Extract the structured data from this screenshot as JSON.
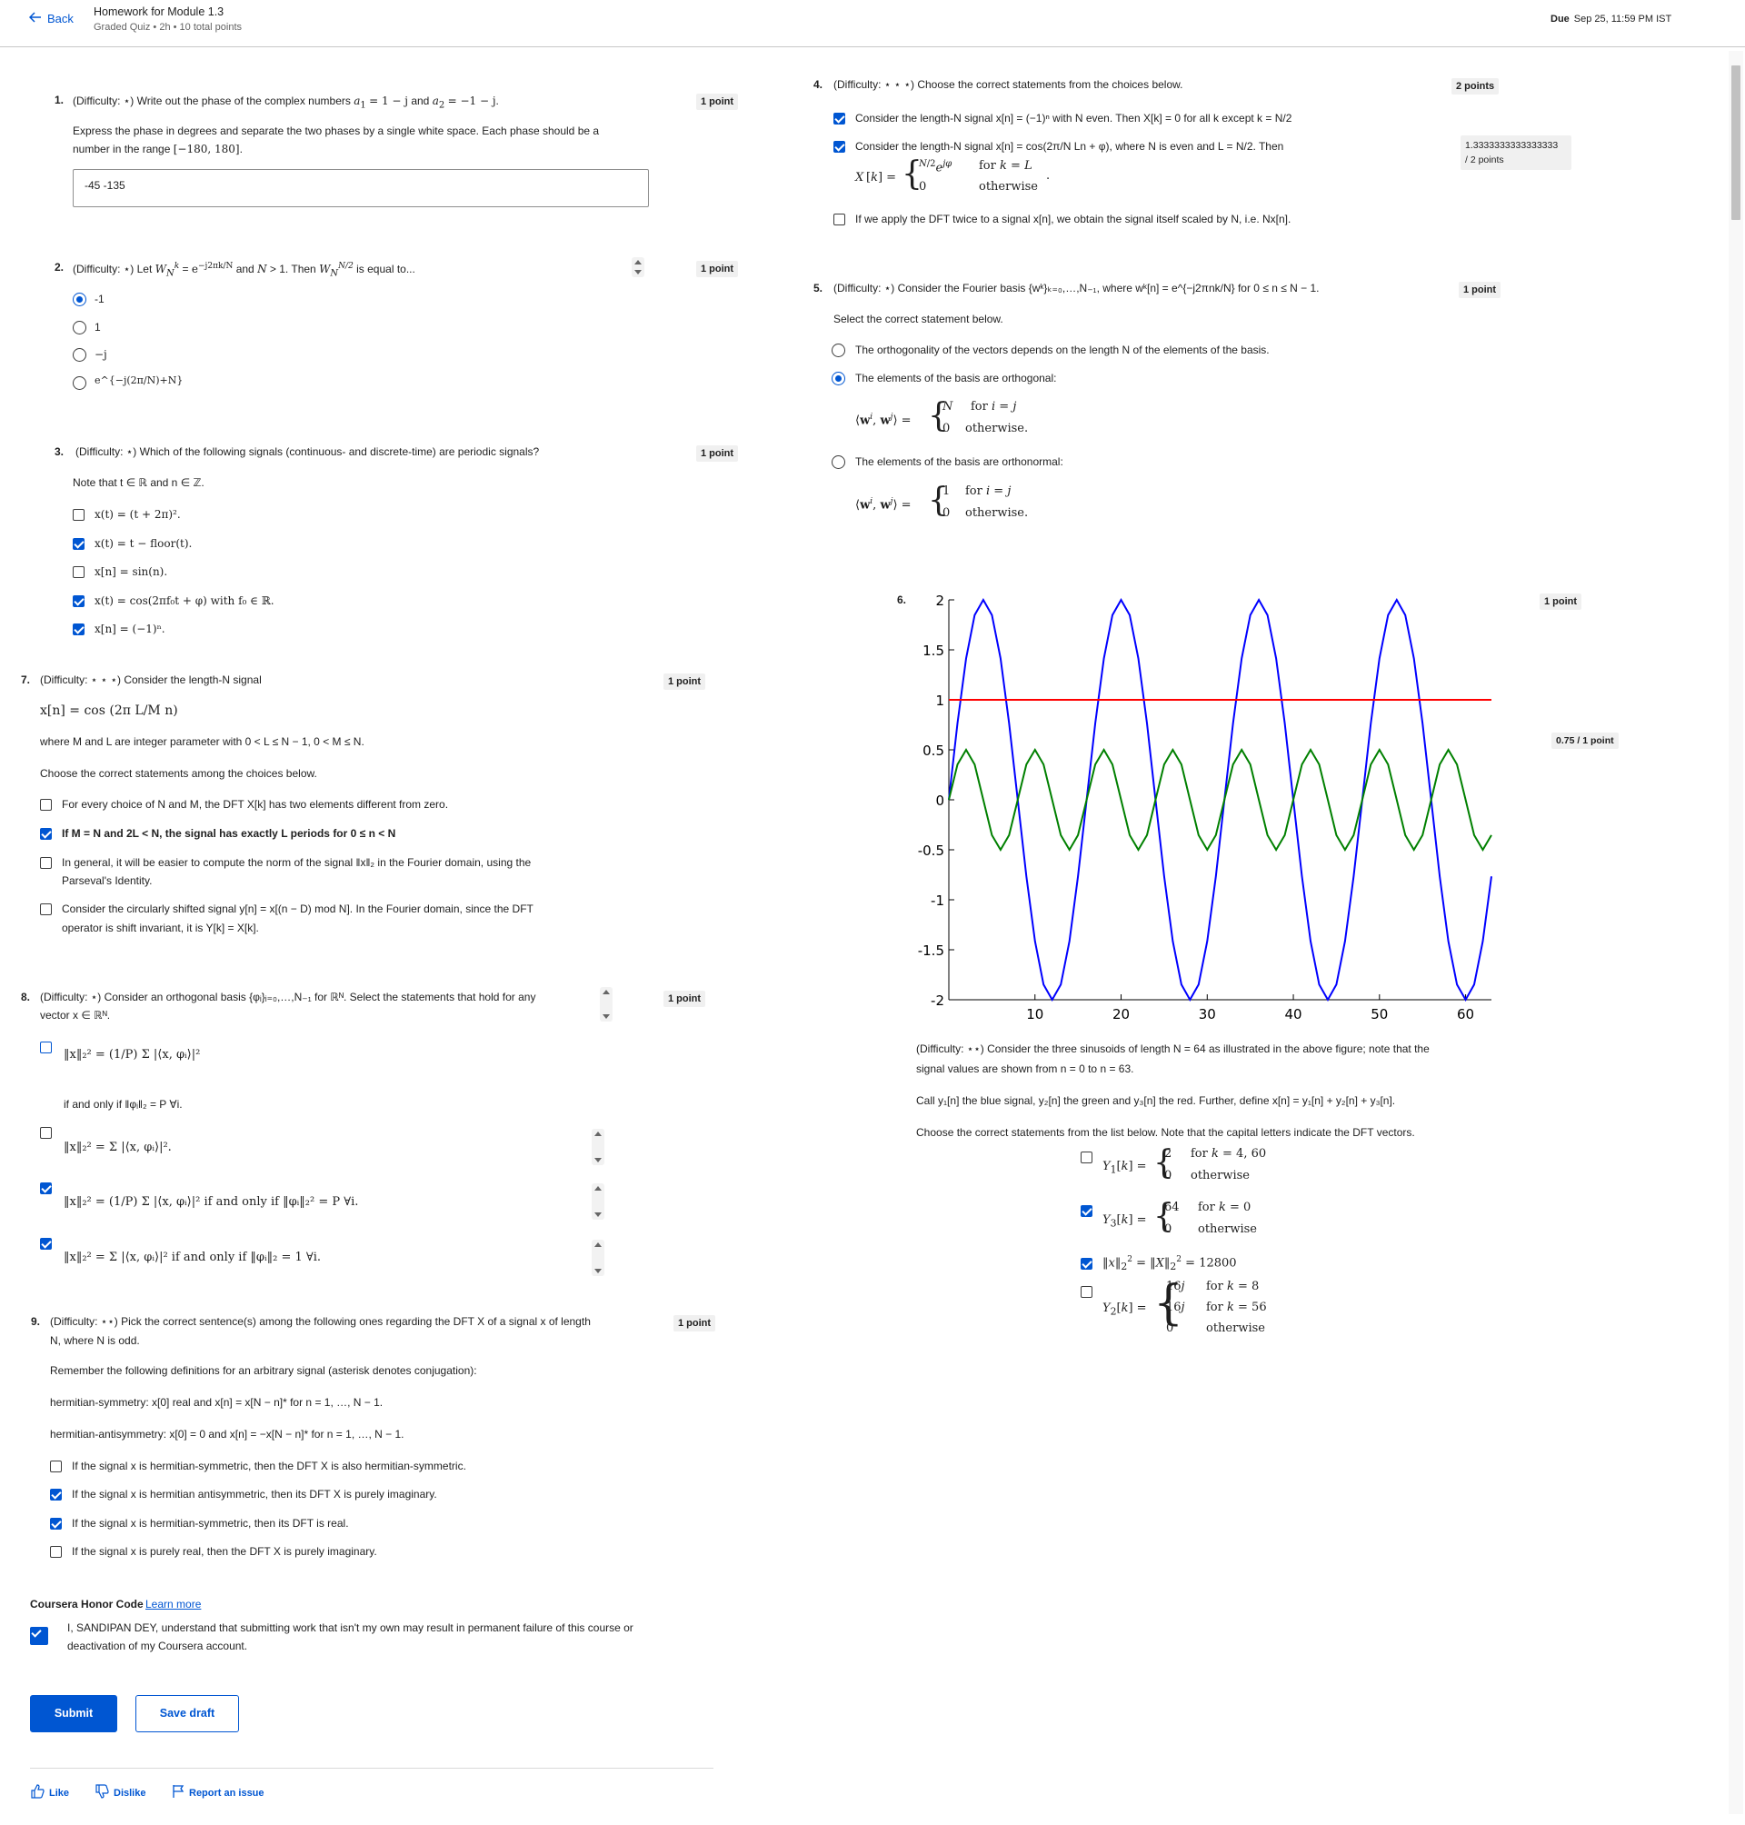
{
  "header": {
    "back": "Back",
    "title": "Homework for Module 1.3",
    "subtitle": "Graded Quiz • 2h • 10 total points",
    "due_label": "Due",
    "due_date": "Sep 25, 11:59 PM IST"
  },
  "q1": {
    "num": "1.",
    "points": "1 point",
    "text": "(Difficulty: ⋆) Write out the phase of the complex numbers a₁ = 1 − j and a₂ = −1 − j.",
    "text2": "Express the phase in degrees and separate the two phases by a single white space. Each phase should be a number in the range [−180, 180].",
    "answer": "-45 -135"
  },
  "q2": {
    "num": "2.",
    "points": "1 point",
    "text": "(Difficulty: ⋆) Let W_N^k = e^{−j2πk/N} and N > 1. Then W_N^{N/2} is equal to...",
    "options": [
      "-1",
      "1",
      "−j",
      "e^{−j(2π/N)+N}"
    ],
    "selected": 0
  },
  "q3": {
    "num": "3.",
    "points": "1 point",
    "text": "(Difficulty: ⋆) Which of the following signals (continuous- and discrete-time) are periodic signals?",
    "note": "Note that t ∈ ℝ and n ∈ ℤ.",
    "options": [
      "x(t) = (t + 2π)².",
      "x(t) = t − floor(t).",
      "x[n] = sin(n).",
      "x(t) = cos(2πf₀t + φ) with f₀ ∈ ℝ.",
      "x[n] = (−1)ⁿ."
    ],
    "checked": [
      false,
      true,
      false,
      true,
      true
    ]
  },
  "q7": {
    "num": "7.",
    "points": "1 point",
    "text": "(Difficulty: ⋆ ⋆ ⋆) Consider the length-N signal",
    "formula": "x[n] = cos (2π L/M n)",
    "where": "where M and L are integer parameter with 0 < L ≤ N − 1, 0 < M ≤ N.",
    "choose": "Choose the correct statements among the choices below.",
    "options": [
      "For every choice of N and M, the DFT X[k] has two elements different from zero.",
      "If M = N and 2L < N, the signal has exactly L periods for 0 ≤ n < N",
      "In general, it will be easier to compute the norm of the signal ‖x‖₂ in the Fourier domain, using the",
      "Consider the circularly shifted signal y[n] = x[(n − D)  mod N]. In the Fourier domain, since the DFT"
    ],
    "options_l2": [
      "",
      "",
      "Parseval's Identity.",
      "operator is shift invariant, it is Y[k] = X[k]."
    ],
    "checked": [
      false,
      true,
      false,
      false
    ]
  },
  "q8": {
    "num": "8.",
    "points": "1 point",
    "text": "(Difficulty: ⋆) Consider an orthogonal basis {φᵢ}ᵢ₌₀,…,N₋₁ for ℝᴺ. Select the statements that hold for any",
    "text2": "vector x ∈ ℝᴺ.",
    "opt1": "‖x‖₂² = (1/P) Σ |⟨x, φᵢ⟩|²",
    "opt1b": "if and only if ‖φᵢ‖₂ = P ∀i.",
    "opt2": "‖x‖₂² = Σ |⟨x, φᵢ⟩|².",
    "opt3": "‖x‖₂² = (1/P) Σ |⟨x, φᵢ⟩|² if and only if ‖φᵢ‖₂² = P ∀i.",
    "opt4": "‖x‖₂² = Σ |⟨x, φᵢ⟩|² if and only if ‖φᵢ‖₂ = 1 ∀i.",
    "checked": [
      false,
      false,
      true,
      true
    ]
  },
  "q9": {
    "num": "9.",
    "points": "1 point",
    "text": "(Difficulty: ⋆⋆) Pick the correct sentence(s) among the following ones regarding the DFT X of a signal x of length",
    "text2": "N, where N is odd.",
    "remember": "Remember the following definitions for an arbitrary signal (asterisk denotes conjugation):",
    "herm": "hermitian-symmetry: x[0] real and x[n] = x[N − n]* for n = 1, …, N − 1.",
    "antiherm": "hermitian-antisymmetry: x[0] = 0 and x[n] = −x[N − n]* for n = 1, …, N − 1.",
    "options": [
      "If the signal x is hermitian-symmetric, then the DFT X is also hermitian-symmetric.",
      "If the signal x is hermitian antisymmetric, then its DFT X is purely imaginary.",
      "If the signal x is hermitian-symmetric, then its DFT is real.",
      "If the signal x is purely real, then the DFT X is purely imaginary."
    ],
    "checked": [
      false,
      true,
      true,
      false
    ]
  },
  "honor": {
    "title": "Coursera Honor Code",
    "learn": "Learn more",
    "text": "I, SANDIPAN DEY, understand that submitting work that isn't my own may result in permanent failure of this course or",
    "text2": "deactivation of my Coursera account."
  },
  "buttons": {
    "submit": "Submit",
    "save": "Save draft",
    "like": "Like",
    "dislike": "Dislike",
    "report": "Report an issue"
  },
  "q4": {
    "num": "4.",
    "points": "2 points",
    "score": "1.3333333333333333",
    "score2": "/ 2 points",
    "text": "(Difficulty: ⋆ ⋆ ⋆) Choose the correct statements from the choices below.",
    "options": [
      "Consider the length-N signal x[n] = (−1)ⁿ with N even. Then X[k] = 0 for all k except k = N/2",
      "Consider the length-N signal x[n] = cos(2π/N Ln + φ), where N is even and L = N/2. Then",
      "If we apply the DFT twice to a signal x[n], we obtain the signal itself scaled by N, i.e. Nx[n]."
    ],
    "checked": [
      true,
      true,
      false
    ]
  },
  "q5": {
    "num": "5.",
    "points": "1 point",
    "text": "(Difficulty: ⋆) Consider the Fourier basis {wᵏ}ₖ₌₀,…,N₋₁, where wᵏ[n] = e^{−j2πnk/N} for 0 ≤ n ≤ N − 1.",
    "select": "Select the correct statement below.",
    "options": [
      "The orthogonality of the vectors depends on the length N of the elements of the basis.",
      "The elements of the basis are orthogonal:",
      "The elements of the basis are orthonormal:"
    ],
    "selected": 1
  },
  "q6": {
    "num": "6.",
    "points": "1 point",
    "score": "0.75 / 1 point",
    "text": "(Difficulty: ⋆⋆) Consider the three sinusoids of length N = 64 as illustrated in the above figure; note that the",
    "text2": "signal values are shown from n = 0 to n = 63.",
    "call": "Call y₁[n] the blue signal, y₂[n] the green and y₃[n] the red. Further, define x[n] = y₁[n] + y₂[n] + y₃[n].",
    "choose": "Choose the correct statements from the list below. Note that the capital letters indicate the DFT vectors.",
    "checked": [
      false,
      true,
      true,
      false
    ]
  },
  "chart_data": {
    "type": "line",
    "xlim": [
      0,
      63
    ],
    "ylim": [
      -2,
      2
    ],
    "xticks": [
      10,
      20,
      30,
      40,
      50,
      60
    ],
    "yticks": [
      "2",
      "1.5",
      "1",
      "0.5",
      "0",
      "-0.5",
      "-1",
      "-1.5",
      "-2"
    ],
    "series": [
      {
        "color": "#0000ff",
        "amplitude": 2,
        "cycles": 4
      },
      {
        "color": "#008000",
        "amplitude": 0.5,
        "cycles": 8
      },
      {
        "color": "#ff0000",
        "constant": 1
      }
    ]
  },
  "colors": {
    "accent": "#0056d2",
    "badge": "#f0f0f0"
  }
}
